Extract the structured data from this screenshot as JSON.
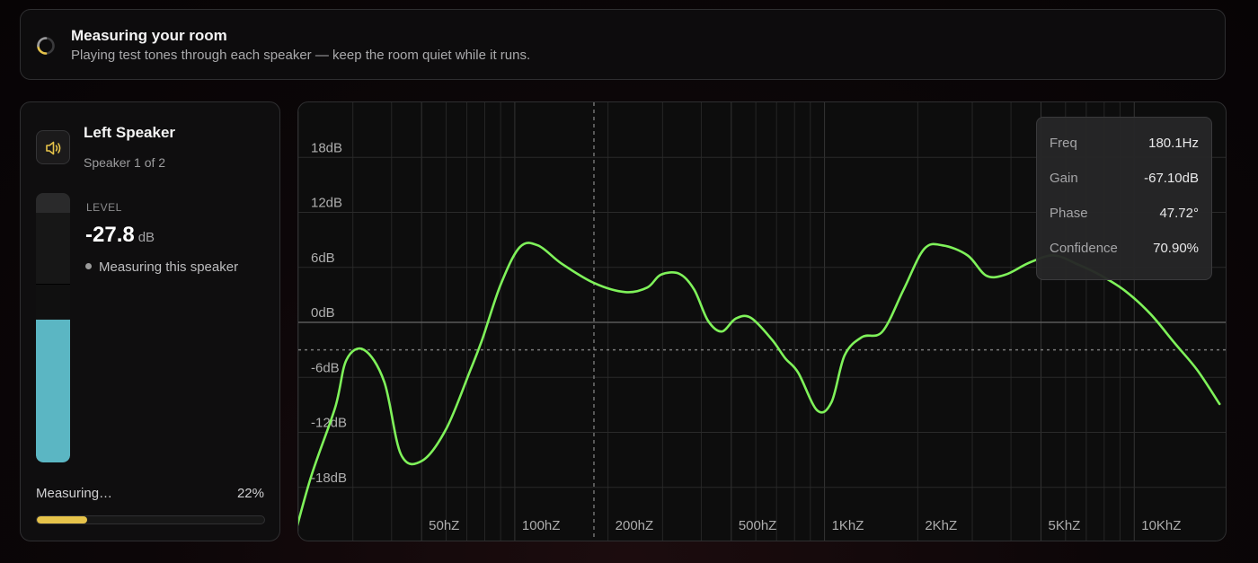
{
  "banner": {
    "title": "Measuring your room",
    "subtitle": "Playing test tones through each speaker — keep the room quiet while it runs.",
    "spinner_icon": "loading-spinner-icon",
    "accent_color": "#e6c34a"
  },
  "speaker": {
    "name": "Left Speaker",
    "index_text": "Speaker 1 of 2",
    "icon": "speaker-volume-icon",
    "level_label": "LEVEL",
    "level_value": "-27.8",
    "level_unit": "dB",
    "status": "Measuring this speaker",
    "meter_fill_fraction": 0.53,
    "meter_color": "#5bb6c3"
  },
  "progress": {
    "label": "Measuring…",
    "percent_text": "22%",
    "fraction": 0.22,
    "color": "#e6c34a"
  },
  "tooltip": {
    "rows": [
      {
        "key": "Freq",
        "value": "180.1Hz"
      },
      {
        "key": "Gain",
        "value": "-67.10dB"
      },
      {
        "key": "Phase",
        "value": "47.72°"
      },
      {
        "key": "Confidence",
        "value": "70.90%"
      }
    ]
  },
  "chart_data": {
    "type": "line",
    "x_scale": "log",
    "xlim": [
      20,
      20000
    ],
    "ylim": [
      -24,
      24
    ],
    "y_ticks": [
      {
        "value": 18,
        "label": "18dB"
      },
      {
        "value": 12,
        "label": "12dB"
      },
      {
        "value": 6,
        "label": "6dB"
      },
      {
        "value": 0,
        "label": "0dB"
      },
      {
        "value": -6,
        "label": "-6dB"
      },
      {
        "value": -12,
        "label": "-12dB"
      },
      {
        "value": -18,
        "label": "-18dB"
      }
    ],
    "x_ticks": [
      {
        "value": 50,
        "label": "50hZ"
      },
      {
        "value": 100,
        "label": "100hZ"
      },
      {
        "value": 200,
        "label": "200hZ"
      },
      {
        "value": 500,
        "label": "500hZ"
      },
      {
        "value": 1000,
        "label": "1KhZ"
      },
      {
        "value": 2000,
        "label": "2KhZ"
      },
      {
        "value": 5000,
        "label": "5KhZ"
      },
      {
        "value": 10000,
        "label": "10KhZ"
      }
    ],
    "reference_level_db": -3,
    "cursor_freq": 180.1,
    "grid": true,
    "line_color": "#7ff25a",
    "series": [
      {
        "x": [
          19.2,
          22,
          26.3,
          28.6,
          32.6,
          37.9,
          42.9,
          50.2,
          60.1,
          71.7,
          78.6,
          90,
          103.7,
          118.8,
          141.7,
          180,
          227.6,
          267.8,
          296.1,
          339.7,
          379.1,
          420.3,
          465.8,
          516.3,
          578,
          676.9,
          745.7,
          822.4,
          946.8,
          1053.8,
          1161.1,
          1322.5,
          1538.6,
          1801.5,
          2097.6,
          2407.8,
          2899.3,
          3326.2,
          3837.5,
          4581.6,
          5493.6,
          6596.4,
          7816.3,
          9375,
          11293.4,
          13537.8,
          15978.6,
          18854.9
        ],
        "y": [
          -24,
          -16.8,
          -9.3,
          -4.1,
          -3,
          -6.5,
          -14.4,
          -15.1,
          -11.6,
          -5.3,
          -1.8,
          4.1,
          8.2,
          8.4,
          6.4,
          4.3,
          3.3,
          3.8,
          5.2,
          5.3,
          3.6,
          0.2,
          -1,
          0.4,
          0.5,
          -1.9,
          -3.9,
          -5.5,
          -9.6,
          -8.7,
          -3.6,
          -1.6,
          -1,
          3.6,
          8,
          8.4,
          7.3,
          5.1,
          5.2,
          6.5,
          7.3,
          6.3,
          5.1,
          3.4,
          0.9,
          -2.3,
          -5.2,
          -8.9
        ]
      }
    ]
  }
}
